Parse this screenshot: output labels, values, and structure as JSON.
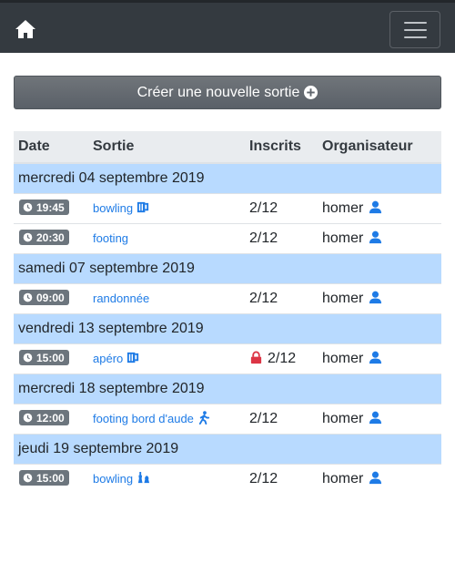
{
  "navbar": {
    "home_icon": "home-icon",
    "menu_icon": "hamburger-icon"
  },
  "create_button": {
    "label": "Créer une nouvelle sortie",
    "icon": "plus-circle-icon"
  },
  "table": {
    "headers": {
      "date": "Date",
      "sortie": "Sortie",
      "inscrits": "Inscrits",
      "organisateur": "Organisateur"
    },
    "groups": [
      {
        "day": "mercredi 04 septembre 2019",
        "events": [
          {
            "time": "19:45",
            "name": "bowling",
            "icon": "beer-icon",
            "inscrits": "2/12",
            "locked": false,
            "organizer": "homer"
          },
          {
            "time": "20:30",
            "name": "footing",
            "icon": "",
            "inscrits": "2/12",
            "locked": false,
            "organizer": "homer"
          }
        ]
      },
      {
        "day": "samedi 07 septembre 2019",
        "events": [
          {
            "time": "09:00",
            "name": "randonnée",
            "icon": "",
            "inscrits": "2/12",
            "locked": false,
            "organizer": "homer"
          }
        ]
      },
      {
        "day": "vendredi 13 septembre 2019",
        "events": [
          {
            "time": "15:00",
            "name": "apéro",
            "icon": "beer-icon",
            "inscrits": "2/12",
            "locked": true,
            "organizer": "homer"
          }
        ]
      },
      {
        "day": "mercredi 18 septembre 2019",
        "events": [
          {
            "time": "12:00",
            "name": "footing bord d'aude",
            "icon": "walking-icon",
            "inscrits": "2/12",
            "locked": false,
            "organizer": "homer"
          }
        ]
      },
      {
        "day": "jeudi 19 septembre 2019",
        "events": [
          {
            "time": "15:00",
            "name": "bowling",
            "icon": "chess-icon",
            "inscrits": "2/12",
            "locked": false,
            "organizer": "homer"
          }
        ]
      }
    ]
  },
  "colors": {
    "navbar": "#343a40",
    "link": "#1e7be6",
    "day_row": "#b8daff",
    "badge": "#6c757d",
    "lock": "#dc3545",
    "user": "#1e7be6"
  }
}
